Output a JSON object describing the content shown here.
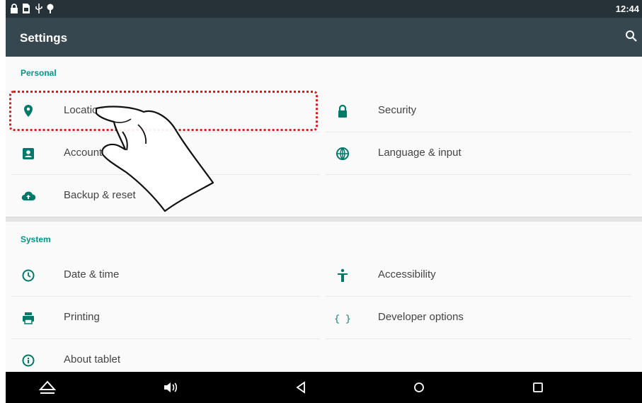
{
  "status_bar": {
    "icons": [
      "lock-icon",
      "sim-card-icon",
      "usb-icon",
      "download-icon"
    ],
    "time": "12:44"
  },
  "app_bar": {
    "title": "Settings",
    "search_icon": "search-icon"
  },
  "sections": {
    "personal": {
      "header": "Personal",
      "items": [
        {
          "label": "Location",
          "icon": "location-pin-icon"
        },
        {
          "label": "Security",
          "icon": "lock-icon"
        },
        {
          "label": "Accounts",
          "icon": "account-box-icon"
        },
        {
          "label": "Language & input",
          "icon": "globe-icon"
        },
        {
          "label": "Backup & reset",
          "icon": "cloud-upload-icon"
        }
      ]
    },
    "system": {
      "header": "System",
      "items": [
        {
          "label": "Date & time",
          "icon": "clock-icon"
        },
        {
          "label": "Accessibility",
          "icon": "accessibility-icon"
        },
        {
          "label": "Printing",
          "icon": "printer-icon"
        },
        {
          "label": "Developer options",
          "icon": "braces-icon"
        },
        {
          "label": "About tablet",
          "icon": "info-icon"
        }
      ]
    }
  },
  "nav_bar": {
    "icons": [
      "eject-up-icon",
      "volume-icon",
      "back-icon",
      "home-icon",
      "recents-icon"
    ]
  },
  "overlay": {
    "highlight_target": "Location",
    "pointer": "hand-pointer-icon"
  },
  "colors": {
    "accent": "#009688",
    "status_bar": "#263238",
    "app_bar": "#37474f",
    "highlight": "#d51f1f"
  }
}
